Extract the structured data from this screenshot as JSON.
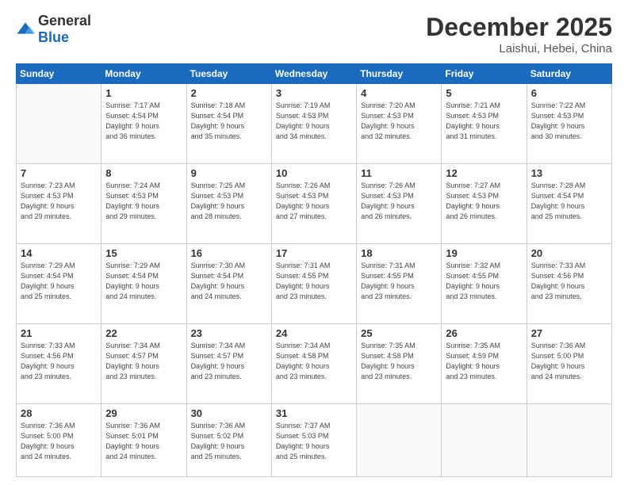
{
  "header": {
    "logo_general": "General",
    "logo_blue": "Blue",
    "month": "December 2025",
    "location": "Laishui, Hebei, China"
  },
  "weekdays": [
    "Sunday",
    "Monday",
    "Tuesday",
    "Wednesday",
    "Thursday",
    "Friday",
    "Saturday"
  ],
  "weeks": [
    [
      {
        "day": "",
        "info": ""
      },
      {
        "day": "1",
        "info": "Sunrise: 7:17 AM\nSunset: 4:54 PM\nDaylight: 9 hours\nand 36 minutes."
      },
      {
        "day": "2",
        "info": "Sunrise: 7:18 AM\nSunset: 4:54 PM\nDaylight: 9 hours\nand 35 minutes."
      },
      {
        "day": "3",
        "info": "Sunrise: 7:19 AM\nSunset: 4:53 PM\nDaylight: 9 hours\nand 34 minutes."
      },
      {
        "day": "4",
        "info": "Sunrise: 7:20 AM\nSunset: 4:53 PM\nDaylight: 9 hours\nand 32 minutes."
      },
      {
        "day": "5",
        "info": "Sunrise: 7:21 AM\nSunset: 4:53 PM\nDaylight: 9 hours\nand 31 minutes."
      },
      {
        "day": "6",
        "info": "Sunrise: 7:22 AM\nSunset: 4:53 PM\nDaylight: 9 hours\nand 30 minutes."
      }
    ],
    [
      {
        "day": "7",
        "info": "Sunrise: 7:23 AM\nSunset: 4:53 PM\nDaylight: 9 hours\nand 29 minutes."
      },
      {
        "day": "8",
        "info": "Sunrise: 7:24 AM\nSunset: 4:53 PM\nDaylight: 9 hours\nand 29 minutes."
      },
      {
        "day": "9",
        "info": "Sunrise: 7:25 AM\nSunset: 4:53 PM\nDaylight: 9 hours\nand 28 minutes."
      },
      {
        "day": "10",
        "info": "Sunrise: 7:26 AM\nSunset: 4:53 PM\nDaylight: 9 hours\nand 27 minutes."
      },
      {
        "day": "11",
        "info": "Sunrise: 7:26 AM\nSunset: 4:53 PM\nDaylight: 9 hours\nand 26 minutes."
      },
      {
        "day": "12",
        "info": "Sunrise: 7:27 AM\nSunset: 4:53 PM\nDaylight: 9 hours\nand 26 minutes."
      },
      {
        "day": "13",
        "info": "Sunrise: 7:28 AM\nSunset: 4:54 PM\nDaylight: 9 hours\nand 25 minutes."
      }
    ],
    [
      {
        "day": "14",
        "info": "Sunrise: 7:29 AM\nSunset: 4:54 PM\nDaylight: 9 hours\nand 25 minutes."
      },
      {
        "day": "15",
        "info": "Sunrise: 7:29 AM\nSunset: 4:54 PM\nDaylight: 9 hours\nand 24 minutes."
      },
      {
        "day": "16",
        "info": "Sunrise: 7:30 AM\nSunset: 4:54 PM\nDaylight: 9 hours\nand 24 minutes."
      },
      {
        "day": "17",
        "info": "Sunrise: 7:31 AM\nSunset: 4:55 PM\nDaylight: 9 hours\nand 23 minutes."
      },
      {
        "day": "18",
        "info": "Sunrise: 7:31 AM\nSunset: 4:55 PM\nDaylight: 9 hours\nand 23 minutes."
      },
      {
        "day": "19",
        "info": "Sunrise: 7:32 AM\nSunset: 4:55 PM\nDaylight: 9 hours\nand 23 minutes."
      },
      {
        "day": "20",
        "info": "Sunrise: 7:33 AM\nSunset: 4:56 PM\nDaylight: 9 hours\nand 23 minutes."
      }
    ],
    [
      {
        "day": "21",
        "info": "Sunrise: 7:33 AM\nSunset: 4:56 PM\nDaylight: 9 hours\nand 23 minutes."
      },
      {
        "day": "22",
        "info": "Sunrise: 7:34 AM\nSunset: 4:57 PM\nDaylight: 9 hours\nand 23 minutes."
      },
      {
        "day": "23",
        "info": "Sunrise: 7:34 AM\nSunset: 4:57 PM\nDaylight: 9 hours\nand 23 minutes."
      },
      {
        "day": "24",
        "info": "Sunrise: 7:34 AM\nSunset: 4:58 PM\nDaylight: 9 hours\nand 23 minutes."
      },
      {
        "day": "25",
        "info": "Sunrise: 7:35 AM\nSunset: 4:58 PM\nDaylight: 9 hours\nand 23 minutes."
      },
      {
        "day": "26",
        "info": "Sunrise: 7:35 AM\nSunset: 4:59 PM\nDaylight: 9 hours\nand 23 minutes."
      },
      {
        "day": "27",
        "info": "Sunrise: 7:36 AM\nSunset: 5:00 PM\nDaylight: 9 hours\nand 24 minutes."
      }
    ],
    [
      {
        "day": "28",
        "info": "Sunrise: 7:36 AM\nSunset: 5:00 PM\nDaylight: 9 hours\nand 24 minutes."
      },
      {
        "day": "29",
        "info": "Sunrise: 7:36 AM\nSunset: 5:01 PM\nDaylight: 9 hours\nand 24 minutes."
      },
      {
        "day": "30",
        "info": "Sunrise: 7:36 AM\nSunset: 5:02 PM\nDaylight: 9 hours\nand 25 minutes."
      },
      {
        "day": "31",
        "info": "Sunrise: 7:37 AM\nSunset: 5:03 PM\nDaylight: 9 hours\nand 25 minutes."
      },
      {
        "day": "",
        "info": ""
      },
      {
        "day": "",
        "info": ""
      },
      {
        "day": "",
        "info": ""
      }
    ]
  ]
}
